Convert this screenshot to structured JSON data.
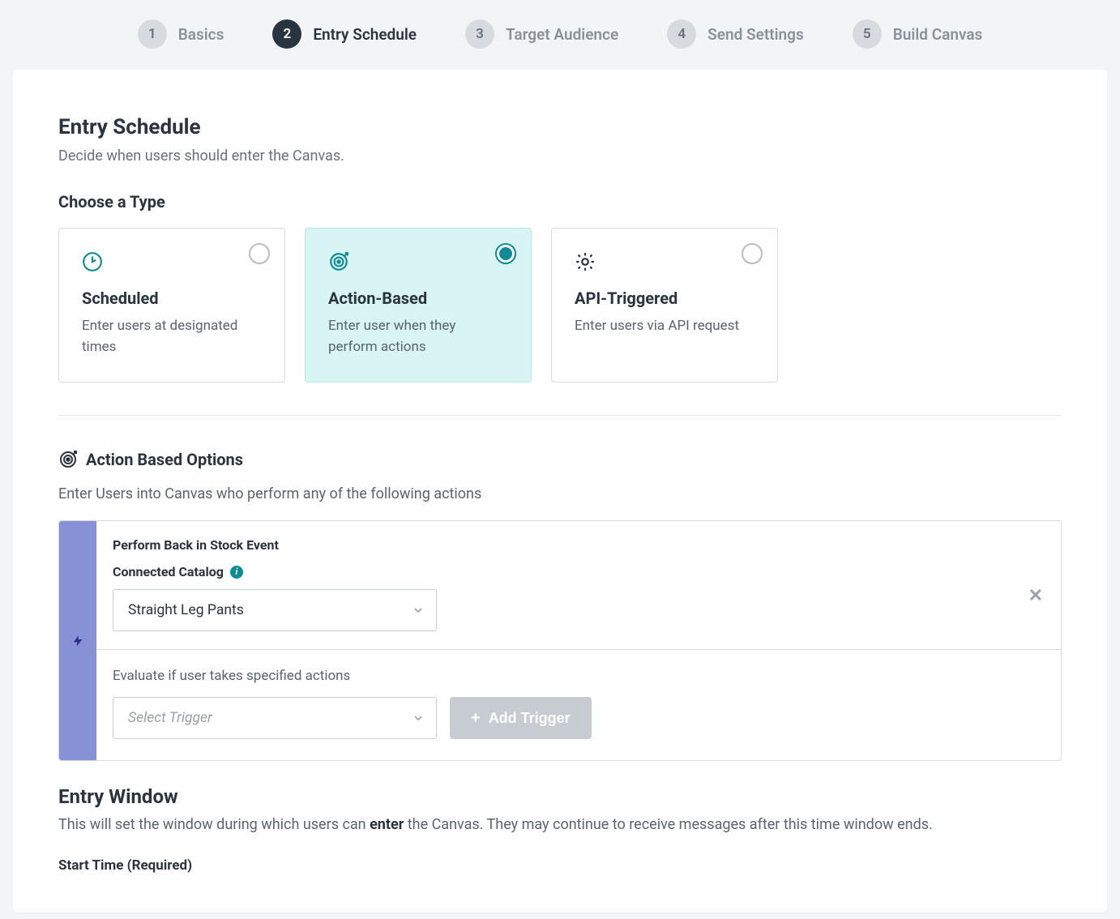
{
  "stepper": {
    "active_index": 1,
    "steps": [
      {
        "num": "1",
        "label": "Basics"
      },
      {
        "num": "2",
        "label": "Entry Schedule"
      },
      {
        "num": "3",
        "label": "Target Audience"
      },
      {
        "num": "4",
        "label": "Send Settings"
      },
      {
        "num": "5",
        "label": "Build Canvas"
      }
    ]
  },
  "header": {
    "title": "Entry Schedule",
    "subtitle": "Decide when users should enter the Canvas."
  },
  "type_section": {
    "heading": "Choose a Type",
    "selected_index": 1,
    "cards": [
      {
        "title": "Scheduled",
        "desc": "Enter users at designated times"
      },
      {
        "title": "Action-Based",
        "desc": "Enter user when they perform actions"
      },
      {
        "title": "API-Triggered",
        "desc": "Enter users via API request"
      }
    ]
  },
  "options_section": {
    "heading": "Action Based Options",
    "subheading": "Enter Users into Canvas who perform any of the following actions",
    "trigger": {
      "title": "Perform Back in Stock Event",
      "catalog_label": "Connected Catalog",
      "catalog_value": "Straight Leg Pants"
    },
    "evaluate_text": "Evaluate if user takes specified actions",
    "select_trigger_placeholder": "Select Trigger",
    "add_trigger_label": "Add Trigger"
  },
  "entry_window": {
    "title": "Entry Window",
    "desc_before": "This will set the window during which users can ",
    "desc_bold": "enter",
    "desc_after": " the Canvas. They may continue to receive messages after this time window ends.",
    "start_time_label": "Start Time (Required)"
  },
  "colors": {
    "accent": "#0f8b95",
    "rail": "#8791d6"
  }
}
